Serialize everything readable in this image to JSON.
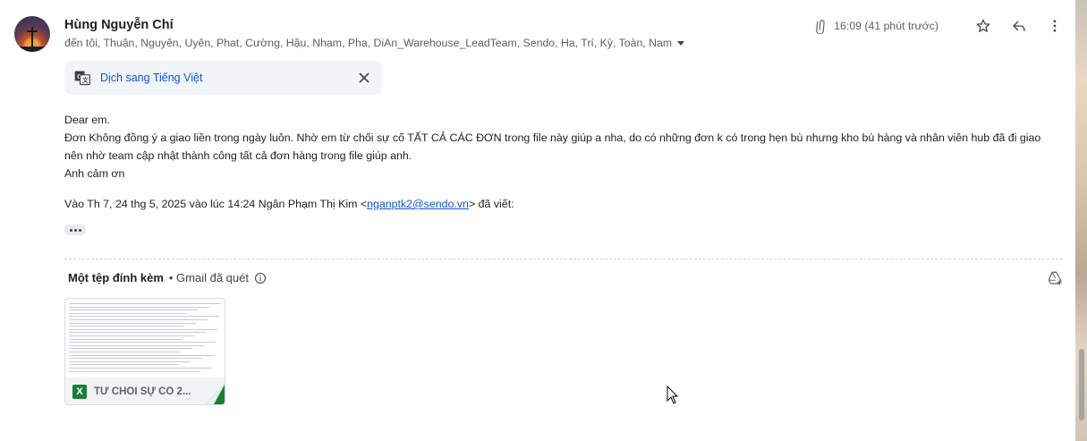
{
  "email": {
    "sender_name": "Hùng Nguyễn Chí",
    "recipients": "đến tôi, Thuận, Nguyên, Uyên, Phat, Cường, Hậu, Nham, Pha, DiAn_Warehouse_LeadTeam, Sendo, Ha, Trí, Kỳ, Toàn, Nam",
    "time": "16:09 (41 phút trước)",
    "translate_label": "Dịch sang Tiếng Việt",
    "body_lines": [
      "Dear em.",
      "Đơn Không đồng ý a giao liền trong ngày luôn. Nhờ em từ chối sự cố TẤT CẢ CÁC ĐƠN trong file này giúp a nha, do có những đơn k có trong hẹn bù nhưng kho bù hàng và nhân viên hub đã đi giao nên nhờ team cập nhật thành công tất cả đơn hàng trong file giúp anh.",
      "Anh cảm ơn"
    ],
    "quote_prefix": "Vào Th 7, 24 thg 5, 2025 vào lúc 14:24 Ngân Phạm Thị Kim <",
    "quote_email": "nganptk2@sendo.vn",
    "quote_suffix": "> đã viết:"
  },
  "attachments": {
    "title": "Một tệp đính kèm",
    "scan_note": "• Gmail đã quét",
    "file_name": "TỪ CHỐI SỰ CỐ 2...",
    "file_type_icon": "X"
  },
  "icons": {
    "attachment": "paperclip-icon",
    "star": "star-icon",
    "reply": "reply-icon",
    "more": "more-vert-icon",
    "translate": "translate-icon",
    "close": "close-icon",
    "info": "info-icon",
    "add_to_drive": "add-to-drive-icon"
  },
  "colors": {
    "link": "#0b57d0",
    "translate_bg": "#f1f4f9",
    "excel_green": "#188038"
  }
}
